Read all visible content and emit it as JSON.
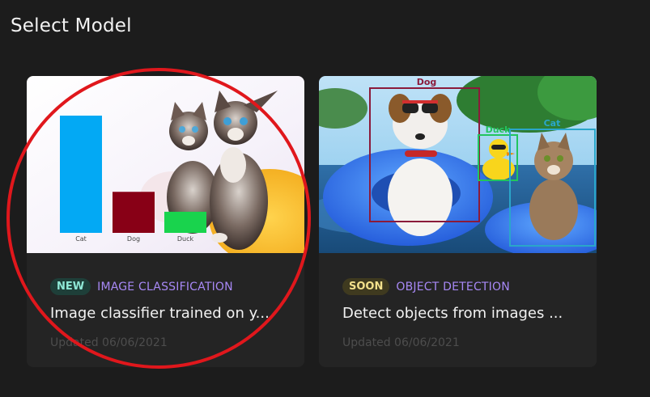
{
  "header": {
    "title": "Select Model"
  },
  "colors": {
    "background": "#1c1c1c",
    "card": "#242424",
    "new_badge": "#8fe8d6",
    "soon_badge": "#f2e08c",
    "category": "#a788f5",
    "annotation": "#e0171c"
  },
  "cards": [
    {
      "badge": "NEW",
      "category": "IMAGE CLASSIFICATION",
      "title": "Image classifier trained on y...",
      "updated": "Updated 06/06/2021",
      "thumbnail": {
        "chart_data": {
          "type": "bar",
          "categories": [
            "Cat",
            "Dog",
            "Duck"
          ],
          "values": [
            100,
            35,
            18
          ],
          "colors": [
            "#03a9f4",
            "#880016",
            "#19d34d"
          ]
        }
      }
    },
    {
      "badge": "SOON",
      "category": "OBJECT DETECTION",
      "title": "Detect objects from images ...",
      "updated": "Updated 06/06/2021",
      "thumbnail": {
        "detections": [
          {
            "label": "Dog",
            "color": "#8b1a3a"
          },
          {
            "label": "Duck",
            "color": "#22c55e"
          },
          {
            "label": "Cat",
            "color": "#2aa6c9"
          }
        ]
      }
    }
  ]
}
